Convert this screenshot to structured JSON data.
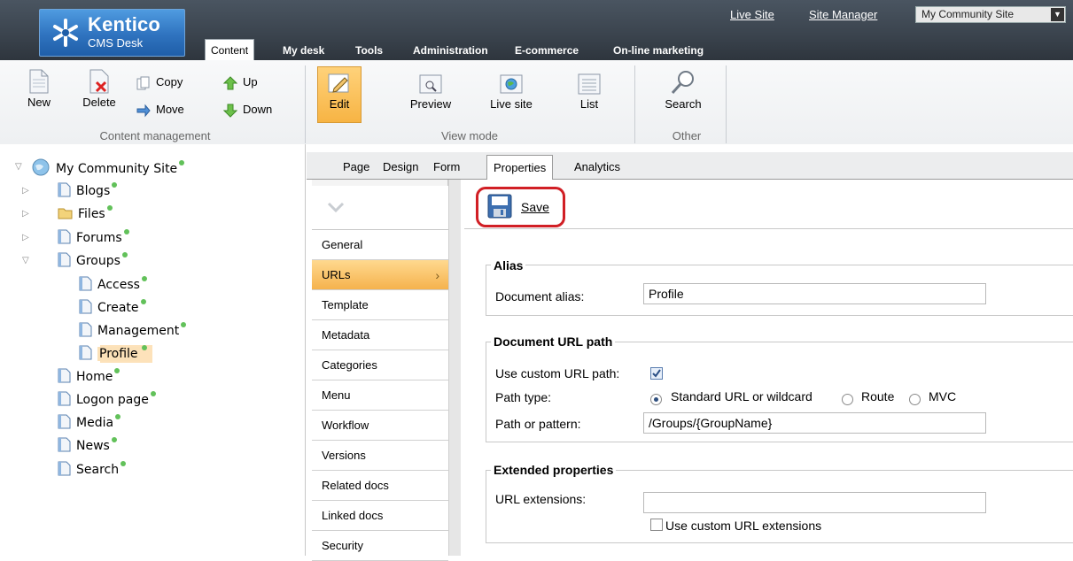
{
  "header": {
    "brand": "Kentico",
    "brand_sub": "CMS Desk",
    "tabs": [
      {
        "label": "Content",
        "active": true
      },
      {
        "label": "My desk"
      },
      {
        "label": "Tools"
      },
      {
        "label": "Administration"
      },
      {
        "label": "E-commerce"
      },
      {
        "label": "On-line marketing"
      }
    ],
    "links": {
      "live_site": "Live Site",
      "site_manager": "Site Manager"
    },
    "site_selector": "My Community Site"
  },
  "ribbon": {
    "new": "New",
    "delete": "Delete",
    "copy": "Copy",
    "move": "Move",
    "up": "Up",
    "down": "Down",
    "edit": "Edit",
    "preview": "Preview",
    "live_site": "Live site",
    "list": "List",
    "search": "Search",
    "groups": {
      "content_management": "Content management",
      "view_mode": "View mode",
      "other": "Other"
    }
  },
  "tree": {
    "root": "My Community Site",
    "items": [
      "Blogs",
      "Files",
      "Forums",
      "Groups",
      "Access",
      "Create",
      "Management",
      "Profile",
      "Home",
      "Logon page",
      "Media",
      "News",
      "Search"
    ]
  },
  "page_tabs": [
    "Page",
    "Design",
    "Form",
    "Properties",
    "Analytics"
  ],
  "active_page_tab": "Properties",
  "side_nav": [
    "General",
    "URLs",
    "Template",
    "Metadata",
    "Categories",
    "Menu",
    "Workflow",
    "Versions",
    "Related docs",
    "Linked docs",
    "Security"
  ],
  "active_side_nav": "URLs",
  "save_label": "Save",
  "form": {
    "alias_legend": "Alias",
    "document_alias_label": "Document alias:",
    "document_alias_value": "Profile",
    "url_path_legend": "Document URL path",
    "use_custom_url_path_label": "Use custom URL path:",
    "use_custom_url_path_checked": true,
    "path_type_label": "Path type:",
    "path_type_options": [
      "Standard URL or wildcard",
      "Route",
      "MVC"
    ],
    "path_type_selected": "Standard URL or wildcard",
    "path_or_pattern_label": "Path or pattern:",
    "path_or_pattern_value": "/Groups/{GroupName}",
    "extended_legend": "Extended properties",
    "url_extensions_label": "URL extensions:",
    "url_extensions_value": "",
    "use_custom_url_extensions_label": "Use custom URL extensions",
    "use_custom_url_extensions_checked": false
  },
  "colors": {
    "accent_orange": "#f7b444",
    "header_dark": "#3a434d",
    "status_green": "#62c15a",
    "highlight_red": "#d11f25"
  }
}
